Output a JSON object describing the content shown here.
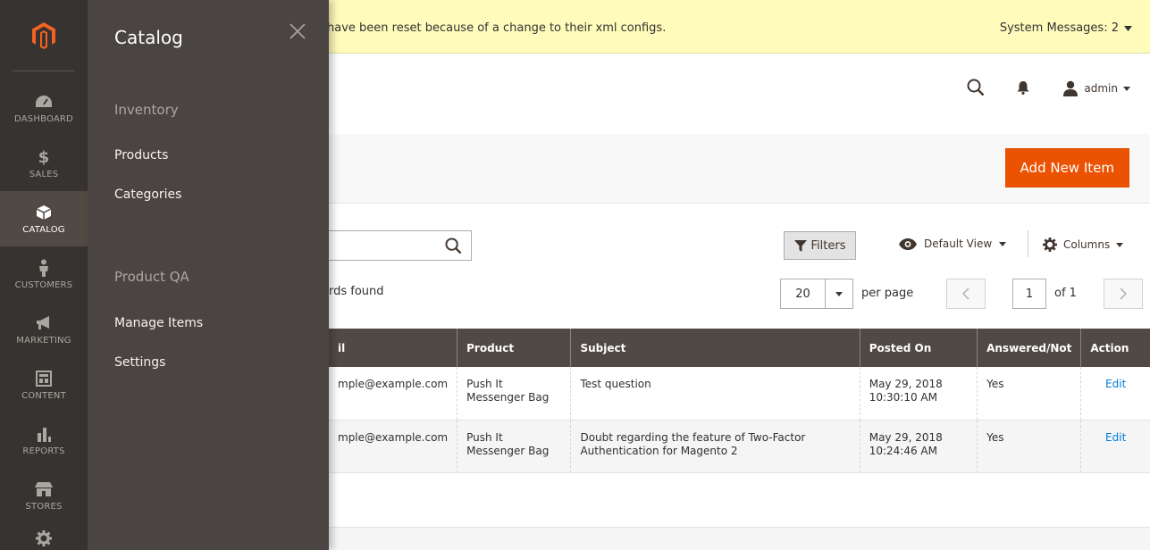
{
  "nav": {
    "items": [
      {
        "label": "DASHBOARD",
        "icon": "dashboard-icon"
      },
      {
        "label": "SALES",
        "icon": "dollar-icon"
      },
      {
        "label": "CATALOG",
        "icon": "box-icon"
      },
      {
        "label": "CUSTOMERS",
        "icon": "person-icon"
      },
      {
        "label": "MARKETING",
        "icon": "megaphone-icon"
      },
      {
        "label": "CONTENT",
        "icon": "layout-icon"
      },
      {
        "label": "REPORTS",
        "icon": "bar-chart-icon"
      },
      {
        "label": "STORES",
        "icon": "store-icon"
      }
    ]
  },
  "flyout": {
    "title": "Catalog",
    "sections": [
      {
        "title": "Inventory",
        "links": [
          "Products",
          "Categories"
        ]
      },
      {
        "title": "Product QA",
        "links": [
          "Manage Items",
          "Settings"
        ]
      }
    ]
  },
  "message_bar": {
    "text": "have been reset because of a change to their xml configs.",
    "system_messages": "System Messages: 2"
  },
  "header": {
    "user": "admin"
  },
  "actions": {
    "add_new": "Add New Item"
  },
  "toolbar": {
    "filters": "Filters",
    "default_view": "Default View",
    "columns": "Columns",
    "records_found": "rds found",
    "per_page_value": "20",
    "per_page_label": "per page",
    "page_value": "1",
    "page_of": "of 1"
  },
  "table": {
    "headers": [
      "il",
      "Product",
      "Subject",
      "Posted On",
      "Answered/Not",
      "Action"
    ],
    "rows": [
      {
        "email": "mple@example.com",
        "product": "Push It Messenger Bag",
        "subject": "Test question",
        "posted_date": "May 29, 2018",
        "posted_time": "10:30:10 AM",
        "answered": "Yes",
        "action": "Edit"
      },
      {
        "email": "mple@example.com",
        "product": "Push It Messenger Bag",
        "subject": "Doubt regarding the feature of Two-Factor Authentication for Magento 2",
        "posted_date": "May 29, 2018",
        "posted_time": "10:24:46 AM",
        "answered": "Yes",
        "action": "Edit"
      }
    ]
  },
  "colors": {
    "nav_bg": "#373330",
    "flyout_bg": "#4a4542",
    "accent": "#eb5202",
    "message_bg": "#fffbbb",
    "table_header": "#514943",
    "link": "#007bdb"
  }
}
